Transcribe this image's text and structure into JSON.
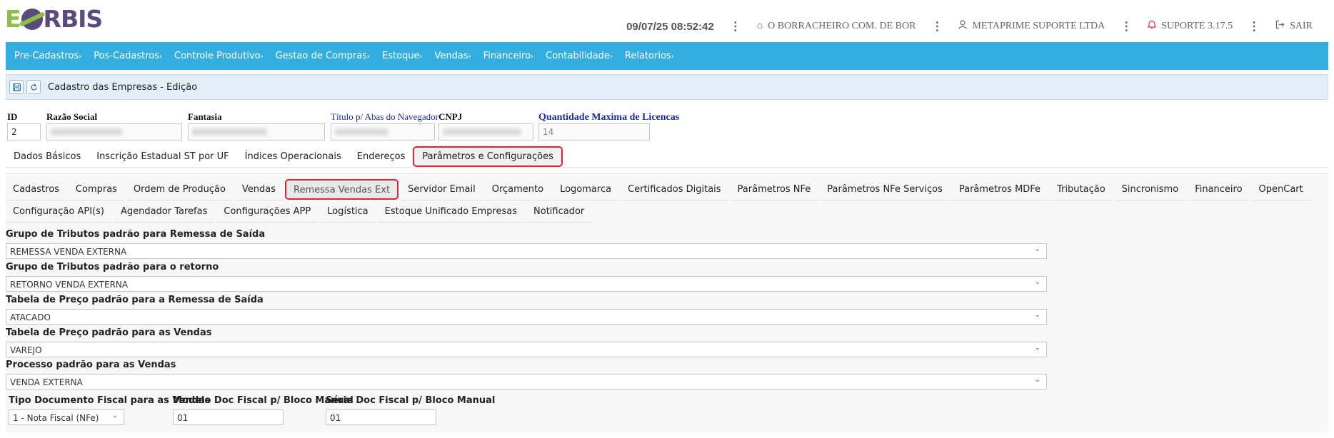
{
  "logo": {
    "e": "E",
    "rbis": "RBIS"
  },
  "topbar": {
    "datetime": "09/07/25 08:52:42",
    "store": "O BORRACHEIRO COM. DE BOR",
    "user": "METAPRIME SUPORTE LTDA",
    "version": "SUPORTE 3.17.5",
    "logout": "SAIR",
    "kebab": "⋮"
  },
  "menu": {
    "items": [
      {
        "label": "Pre-Cadastros"
      },
      {
        "label": "Pos-Cadastros"
      },
      {
        "label": "Controle Produtivo"
      },
      {
        "label": "Gestao de Compras"
      },
      {
        "label": "Estoque"
      },
      {
        "label": "Vendas"
      },
      {
        "label": "Financeiro"
      },
      {
        "label": "Contabilidade"
      },
      {
        "label": "Relatorios"
      }
    ],
    "arrow": "›"
  },
  "titlebar": {
    "title": "Cadastro das Empresas - Edição"
  },
  "header": {
    "id_label": "ID",
    "id_value": "2",
    "razao_label": "Razão Social",
    "fantasia_label": "Fantasia",
    "titulo_label": "Título p/ Abas do Navegador",
    "cnpj_label": "CNPJ",
    "licencas_label": "Quantidade Maxima de Licencas",
    "licencas_value": "14"
  },
  "main_tabs": [
    {
      "label": "Dados Básicos"
    },
    {
      "label": "Inscrição Estadual ST por UF"
    },
    {
      "label": "Índices Operacionais"
    },
    {
      "label": "Endereços"
    },
    {
      "label": "Parâmetros e Configurações"
    }
  ],
  "sub_tabs": [
    {
      "label": "Cadastros"
    },
    {
      "label": "Compras"
    },
    {
      "label": "Ordem de Produção"
    },
    {
      "label": "Vendas"
    },
    {
      "label": "Remessa Vendas Ext"
    },
    {
      "label": "Servidor Email"
    },
    {
      "label": "Orçamento"
    },
    {
      "label": "Logomarca"
    },
    {
      "label": "Certificados Digitais"
    },
    {
      "label": "Parâmetros NFe"
    },
    {
      "label": "Parâmetros NFe Serviços"
    },
    {
      "label": "Parâmetros MDFe"
    },
    {
      "label": "Tributação"
    },
    {
      "label": "Sincronismo"
    },
    {
      "label": "Financeiro"
    },
    {
      "label": "OpenCart"
    },
    {
      "label": "Configuração API(s)"
    },
    {
      "label": "Agendador Tarefas"
    },
    {
      "label": "Configurações APP"
    },
    {
      "label": "Logística"
    },
    {
      "label": "Estoque Unificado Empresas"
    },
    {
      "label": "Notificador"
    }
  ],
  "form": {
    "grupo_saida_label": "Grupo de Tributos padrão para Remessa de Saída",
    "grupo_saida_value": "REMESSA VENDA EXTERNA",
    "grupo_retorno_label": "Grupo de Tributos padrão para o retorno",
    "grupo_retorno_value": "RETORNO VENDA EXTERNA",
    "tabela_remessa_label": "Tabela de Preço padrão para a Remessa de Saída",
    "tabela_remessa_value": "ATACADO",
    "tabela_vendas_label": "Tabela de Preço padrão para as Vendas",
    "tabela_vendas_value": "VAREJO",
    "processo_label": "Processo padrão para as Vendas",
    "processo_value": "VENDA EXTERNA",
    "tipo_doc_label": "Tipo Documento Fiscal para as Vendas",
    "tipo_doc_value": "1 - Nota Fiscal (NFe)",
    "modelo_label": "Modelo Doc Fiscal p/ Bloco Manual",
    "modelo_value": "01",
    "serie_label": "Série Doc Fiscal p/ Bloco Manual",
    "serie_value": "01"
  }
}
